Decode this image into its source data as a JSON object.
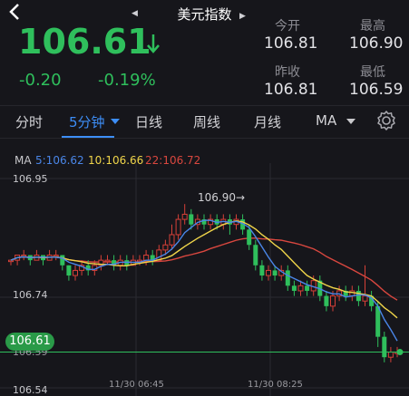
{
  "header": {
    "title": "美元指数"
  },
  "quote": {
    "price": "106.61",
    "change": "-0.20",
    "change_pct": "-0.19%",
    "up_color": "#2fbf5c",
    "stats": [
      {
        "label": "今开",
        "value": "106.81"
      },
      {
        "label": "最高",
        "value": "106.90"
      },
      {
        "label": "昨收",
        "value": "106.81"
      },
      {
        "label": "最低",
        "value": "106.59"
      }
    ]
  },
  "tabs": [
    {
      "label": "分时"
    },
    {
      "label": "5分钟"
    },
    {
      "label": "日线"
    },
    {
      "label": "周线"
    },
    {
      "label": "月线"
    },
    {
      "label": "MA"
    }
  ],
  "active_tab": "5分钟",
  "ma_legend": {
    "title": "MA",
    "ma5": "5:106.62",
    "ma10": "10:106.66",
    "ma22": "22:106.72",
    "colors": {
      "ma5": "#4a86e8",
      "ma10": "#f0d54a",
      "ma22": "#d9473f"
    }
  },
  "chart_data": {
    "type": "candlestick",
    "y_ticks": [
      "106.95",
      "106.74",
      "106.54"
    ],
    "ylim": [
      106.54,
      106.95
    ],
    "x_ticks": [
      "11/30 06:45",
      "11/30 08:25"
    ],
    "current_price_tag": "106.61",
    "low_label": "106.59",
    "high_marker": "106.90→",
    "candles": [
      [
        106.79,
        106.79,
        106.79,
        106.78
      ],
      [
        106.79,
        106.8,
        106.8,
        106.78
      ],
      [
        106.8,
        106.8,
        106.81,
        106.79
      ],
      [
        106.8,
        106.79,
        106.8,
        106.78
      ],
      [
        106.79,
        106.8,
        106.81,
        106.79
      ],
      [
        106.8,
        106.79,
        106.8,
        106.78
      ],
      [
        106.79,
        106.8,
        106.81,
        106.79
      ],
      [
        106.8,
        106.8,
        106.81,
        106.79
      ],
      [
        106.8,
        106.78,
        106.8,
        106.77
      ],
      [
        106.78,
        106.76,
        106.78,
        106.75
      ],
      [
        106.76,
        106.77,
        106.78,
        106.75
      ],
      [
        106.77,
        106.78,
        106.79,
        106.76
      ],
      [
        106.78,
        106.77,
        106.79,
        106.76
      ],
      [
        106.77,
        106.78,
        106.79,
        106.76
      ],
      [
        106.78,
        106.79,
        106.8,
        106.77
      ],
      [
        106.79,
        106.79,
        106.8,
        106.78
      ],
      [
        106.79,
        106.78,
        106.8,
        106.77
      ],
      [
        106.78,
        106.79,
        106.8,
        106.77
      ],
      [
        106.79,
        106.78,
        106.8,
        106.77
      ],
      [
        106.78,
        106.79,
        106.8,
        106.78
      ],
      [
        106.79,
        106.79,
        106.8,
        106.78
      ],
      [
        106.79,
        106.8,
        106.81,
        106.78
      ],
      [
        106.8,
        106.79,
        106.81,
        106.78
      ],
      [
        106.79,
        106.81,
        106.82,
        106.79
      ],
      [
        106.81,
        106.82,
        106.83,
        106.8
      ],
      [
        106.82,
        106.84,
        106.86,
        106.81
      ],
      [
        106.84,
        106.87,
        106.88,
        106.83
      ],
      [
        106.87,
        106.88,
        106.9,
        106.86
      ],
      [
        106.88,
        106.86,
        106.89,
        106.85
      ],
      [
        106.86,
        106.87,
        106.88,
        106.85
      ],
      [
        106.87,
        106.86,
        106.88,
        106.85
      ],
      [
        106.86,
        106.87,
        106.88,
        106.85
      ],
      [
        106.87,
        106.86,
        106.88,
        106.85
      ],
      [
        106.86,
        106.87,
        106.88,
        106.85
      ],
      [
        106.87,
        106.86,
        106.88,
        106.84
      ],
      [
        106.86,
        106.87,
        106.88,
        106.85
      ],
      [
        106.87,
        106.85,
        106.88,
        106.84
      ],
      [
        106.85,
        106.82,
        106.86,
        106.81
      ],
      [
        106.82,
        106.78,
        106.83,
        106.77
      ],
      [
        106.78,
        106.76,
        106.79,
        106.75
      ],
      [
        106.76,
        106.77,
        106.78,
        106.75
      ],
      [
        106.77,
        106.76,
        106.78,
        106.75
      ],
      [
        106.76,
        106.77,
        106.78,
        106.75
      ],
      [
        106.77,
        106.74,
        106.78,
        106.73
      ],
      [
        106.74,
        106.73,
        106.75,
        106.72
      ],
      [
        106.73,
        106.74,
        106.75,
        106.72
      ],
      [
        106.74,
        106.73,
        106.75,
        106.72
      ],
      [
        106.73,
        106.75,
        106.76,
        106.72
      ],
      [
        106.75,
        106.72,
        106.76,
        106.71
      ],
      [
        106.72,
        106.7,
        106.73,
        106.69
      ],
      [
        106.7,
        106.72,
        106.73,
        106.69
      ],
      [
        106.72,
        106.73,
        106.74,
        106.71
      ],
      [
        106.73,
        106.72,
        106.74,
        106.71
      ],
      [
        106.72,
        106.73,
        106.74,
        106.71
      ],
      [
        106.73,
        106.71,
        106.74,
        106.7
      ],
      [
        106.71,
        106.72,
        106.78,
        106.7
      ],
      [
        106.72,
        106.7,
        106.73,
        106.69
      ],
      [
        106.7,
        106.64,
        106.71,
        106.62
      ],
      [
        106.64,
        106.6,
        106.65,
        106.59
      ],
      [
        106.6,
        106.61,
        106.62,
        106.59
      ],
      [
        106.61,
        106.61,
        106.62,
        106.6
      ]
    ]
  }
}
